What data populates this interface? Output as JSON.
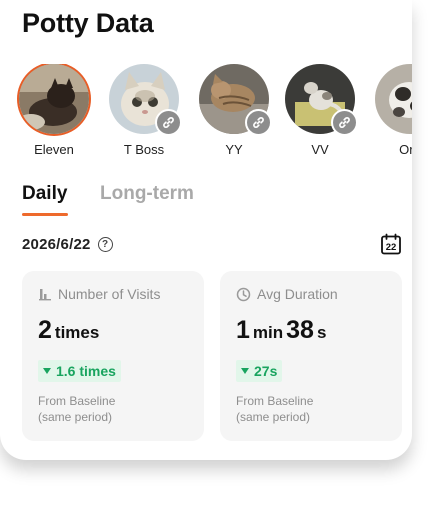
{
  "header": {
    "title": "Potty Data"
  },
  "pets": [
    {
      "name": "Eleven",
      "selected": true,
      "linked": false
    },
    {
      "name": "T Boss",
      "selected": false,
      "linked": true
    },
    {
      "name": "YY",
      "selected": false,
      "linked": true
    },
    {
      "name": "VV",
      "selected": false,
      "linked": true
    },
    {
      "name": "Ore",
      "selected": false,
      "linked": true
    }
  ],
  "tabs": [
    {
      "label": "Daily",
      "active": true
    },
    {
      "label": "Long-term",
      "active": false
    }
  ],
  "date": {
    "value": "2026/6/22",
    "help_icon": "question-circle-icon",
    "calendar_day": "22"
  },
  "stats": {
    "visits": {
      "title": "Number of Visits",
      "icon": "bar-chart-icon",
      "value": "2",
      "unit": "times",
      "delta": "1.6 times",
      "delta_direction": "down",
      "baseline_line1": "From Baseline",
      "baseline_line2": "(same period)"
    },
    "duration": {
      "title": "Avg Duration",
      "icon": "clock-icon",
      "minutes": "1",
      "min_unit": "min",
      "seconds": "38",
      "sec_unit": "s",
      "delta": "27s",
      "delta_direction": "down",
      "baseline_line1": "From Baseline",
      "baseline_line2": "(same period)"
    }
  },
  "colors": {
    "accent": "#ee6a2c",
    "positive_text": "#19a45f",
    "positive_bg": "#e2f6ea",
    "muted": "#8e8e8e"
  }
}
